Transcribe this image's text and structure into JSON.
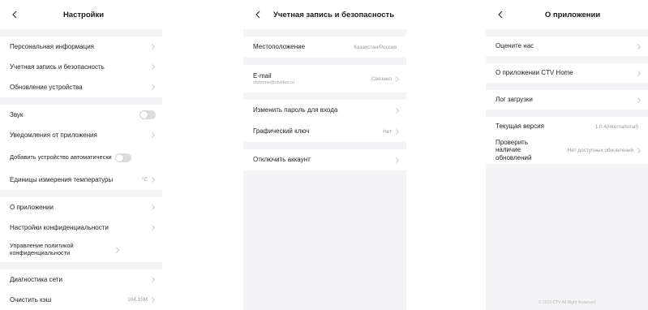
{
  "panel1": {
    "title": "Настройки",
    "groups": [
      [
        {
          "label": "Персональная информация"
        },
        {
          "label": "Учетная запись и безопасность"
        },
        {
          "label": "Обновление устройства"
        }
      ],
      [
        {
          "label": "Звук",
          "toggle": true
        },
        {
          "label": "Уведомления от приложения"
        },
        {
          "label": "Добавить устройство автоматически",
          "toggle": true
        },
        {
          "label": "Единицы измерения температуры",
          "value": "°C"
        }
      ],
      [
        {
          "label": "О приложении"
        },
        {
          "label": "Настройки конфиденциальности"
        },
        {
          "label": "Управление политикой конфиденциальности"
        }
      ],
      [
        {
          "label": "Диагностика сети"
        },
        {
          "label": "Очистить кэш",
          "value": "104.15M"
        }
      ]
    ]
  },
  "panel2": {
    "title": "Учетная запись и безопасность",
    "location_label": "Местоположение",
    "location_value": "Казахстан/Россия",
    "email_label": "E-mail",
    "email_value": "ctvhome@ctvideo.ru",
    "email_status": "Связано",
    "change_password_label": "Изменить пароль для входа",
    "pattern_label": "Графический ключ",
    "pattern_value": "Нет",
    "disable_account_label": "Отключить аккаунт"
  },
  "panel3": {
    "title": "О приложении",
    "rate_label": "Оцените нас",
    "about_label": "О приложении CTV Home",
    "log_label": "Лог загрузки",
    "version_label": "Текущая версия",
    "version_value": "1.0.4(international)",
    "check_label": "Проверить наличие обновлений",
    "check_value": "Нет доступных обновлений",
    "footer": "© 2022 CTV All Right Reserved"
  },
  "colors": {
    "background": "#f4f4f6",
    "row": "#ffffff",
    "toggle_off": "#dcdcdc",
    "muted_text": "#9b9b9b"
  },
  "icons": {
    "back": "back-arrow-icon",
    "chevron": "chevron-right-icon"
  }
}
